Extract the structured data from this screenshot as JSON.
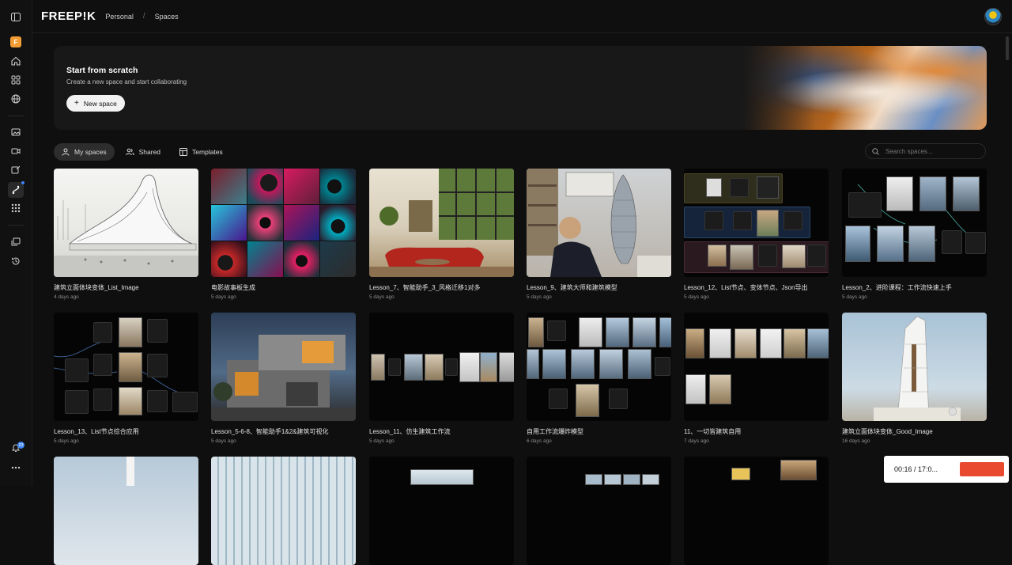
{
  "topbar": {
    "logo": "FREEP!K",
    "breadcrumb": [
      "Personal",
      "Spaces"
    ]
  },
  "sidebar": {
    "icons": [
      "panel-toggle-icon",
      "workspace-icon",
      "home-icon",
      "apps-grid-icon",
      "globe-icon",
      "image-icon",
      "video-icon",
      "edit-image-icon",
      "spaces-icon",
      "grid-icon",
      "stack-icon",
      "history-icon",
      "notification-icon",
      "more-icon"
    ],
    "workspace_letter": "F",
    "notification_count": "23"
  },
  "hero": {
    "title": "Start from scratch",
    "subtitle": "Create a new space and start collaborating",
    "button": "New space"
  },
  "tabs": [
    {
      "label": "My spaces",
      "active": true
    },
    {
      "label": "Shared",
      "active": false
    },
    {
      "label": "Templates",
      "active": false
    }
  ],
  "search": {
    "placeholder": "Search spaces..."
  },
  "cards": [
    {
      "title": "建筑立面体块变体_List_Image",
      "date": "4 days ago"
    },
    {
      "title": "电影故事板生成",
      "date": "5 days ago"
    },
    {
      "title": "Lesson_7、智能助手_3_风格迁移1对多",
      "date": "5 days ago"
    },
    {
      "title": "Lesson_9、建筑大师和建筑模型",
      "date": "5 days ago"
    },
    {
      "title": "Lesson_12、List节点、变体节点、Json导出",
      "date": "5 days ago"
    },
    {
      "title": "Lesson_2、进阶课程：工作流快速上手",
      "date": "5 days ago"
    },
    {
      "title": "Lesson_13、List节点综合应用",
      "date": "5 days ago"
    },
    {
      "title": "Lesson_5-6-8、智能助手1&2&建筑可视化",
      "date": "5 days ago"
    },
    {
      "title": "Lesson_11、仿生建筑工作流",
      "date": "5 days ago"
    },
    {
      "title": "自用工作流爆炸模型",
      "date": "6 days ago"
    },
    {
      "title": "11、一切皆建筑自用",
      "date": "7 days ago"
    },
    {
      "title": "建筑立面体块变体_Good_Image",
      "date": "16 days ago"
    }
  ],
  "player": {
    "time": "00:16 / 17:0..."
  }
}
